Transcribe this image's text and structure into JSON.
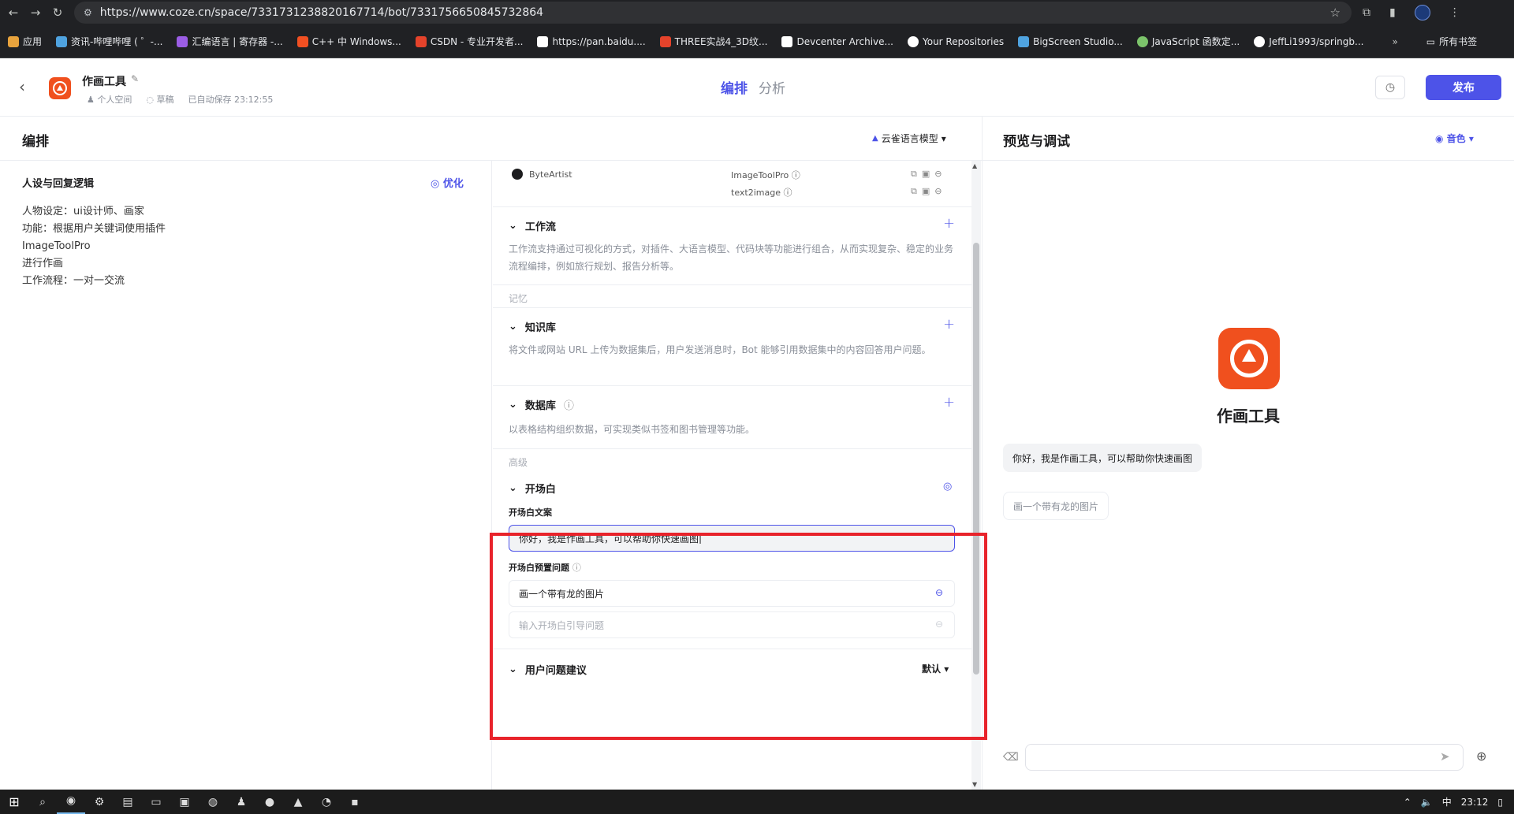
{
  "browser": {
    "url": "https://www.coze.cn/space/7331731238820167714/bot/7331756650845732864",
    "bookmarks": [
      {
        "label": "应用",
        "color": "#e8a33d"
      },
      {
        "label": "资讯-哔哩哔哩 ( ゜-...",
        "color": "#4fa3e0"
      },
      {
        "label": "汇编语言 | 寄存器 -...",
        "color": "#9b5de5"
      },
      {
        "label": "C++ 中 Windows...",
        "color": "#f25022"
      },
      {
        "label": "CSDN - 专业开发者...",
        "color": "#e5432b"
      },
      {
        "label": "https://pan.baidu....",
        "color": "#ffffff"
      },
      {
        "label": "THREE实战4_3D纹...",
        "color": "#e5432b"
      },
      {
        "label": "Devcenter Archive...",
        "color": "#ffffff"
      },
      {
        "label": "Your Repositories",
        "color": "#ffffff"
      },
      {
        "label": "BigScreen Studio...",
        "color": "#4fa3e0"
      },
      {
        "label": "JavaScript 函数定...",
        "color": "#7cc46b"
      },
      {
        "label": "JeffLi1993/springb...",
        "color": "#ffffff"
      }
    ],
    "more": "»",
    "all_bookmarks": "所有书签"
  },
  "header": {
    "bot_name": "作画工具",
    "space": "个人空间",
    "draft": "草稿",
    "autosave": "已自动保存 23:12:55",
    "tab_arrange": "编排",
    "tab_analyze": "分析",
    "publish": "发布"
  },
  "left": {
    "title": "编排",
    "model": "云雀语言模型",
    "persona_title": "人设与回复逻辑",
    "optimize": "优化",
    "persona_lines": [
      "人物设定：ui设计师、画家",
      "功能：根据用户关键词使用插件",
      "ImageToolPro",
      "进行作画",
      "工作流程：一对一交流"
    ]
  },
  "config": {
    "plugin_name": "ByteArtist",
    "tools": [
      "ImageToolPro",
      "text2image"
    ],
    "workflow_title": "工作流",
    "workflow_desc": "工作流支持通过可视化的方式，对插件、大语言模型、代码块等功能进行组合，从而实现复杂、稳定的业务流程编排，例如旅行规划、报告分析等。",
    "memory_label": "记忆",
    "knowledge_title": "知识库",
    "knowledge_desc": "将文件或网站 URL 上传为数据集后，用户发送消息时，Bot 能够引用数据集中的内容回答用户问题。",
    "database_title": "数据库",
    "database_desc": "以表格结构组织数据，可实现类似书签和图书管理等功能。",
    "advanced_label": "高级",
    "opening_title": "开场白",
    "opening_text_label": "开场白文案",
    "opening_text": "你好，我是作画工具，可以帮助你快速画图",
    "preset_label": "开场白预置问题",
    "preset_question": "画一个带有龙的图片",
    "preset_placeholder": "输入开场白引导问题",
    "suggest_title": "用户问题建议",
    "suggest_value": "默认"
  },
  "preview": {
    "title": "预览与调试",
    "voice": "音色",
    "bot_name": "作画工具",
    "greeting": "你好，我是作画工具，可以帮助你快速画图",
    "suggestion": "画一个带有龙的图片"
  },
  "taskbar": {
    "ime": "中",
    "time": "23:12"
  }
}
